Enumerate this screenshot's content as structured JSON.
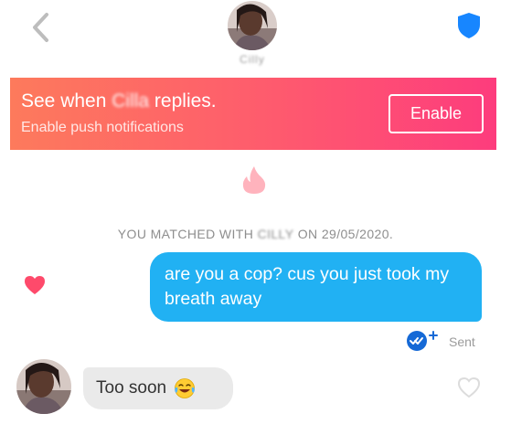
{
  "header": {
    "back_icon": "chevron-left-icon",
    "match_name": "Cilly",
    "shield_icon": "shield-icon",
    "colors": {
      "back": "#bdbdbd",
      "shield": "#1786ff"
    }
  },
  "banner": {
    "title_prefix": "See when ",
    "name": "Cilla",
    "title_suffix": " replies.",
    "subtitle": "Enable push notifications",
    "button_label": "Enable",
    "gradient_start": "#fd7a5c",
    "gradient_end": "#fd3c7d"
  },
  "conversation": {
    "flame_icon": "flame-icon",
    "matched_prefix": "YOU MATCHED WITH ",
    "matched_name": "CILLY",
    "matched_suffix": " ON 29/05/2020.",
    "messages": [
      {
        "direction": "out",
        "text": "are you a cop? cus you just took my breath away",
        "status": "Sent",
        "bubble_color": "#21b1f3"
      },
      {
        "direction": "in",
        "text": "Too soon",
        "emoji": "face-with-tears-of-joy",
        "bubble_color": "#eaeaea"
      }
    ],
    "like_color": "#fe4a6b"
  }
}
